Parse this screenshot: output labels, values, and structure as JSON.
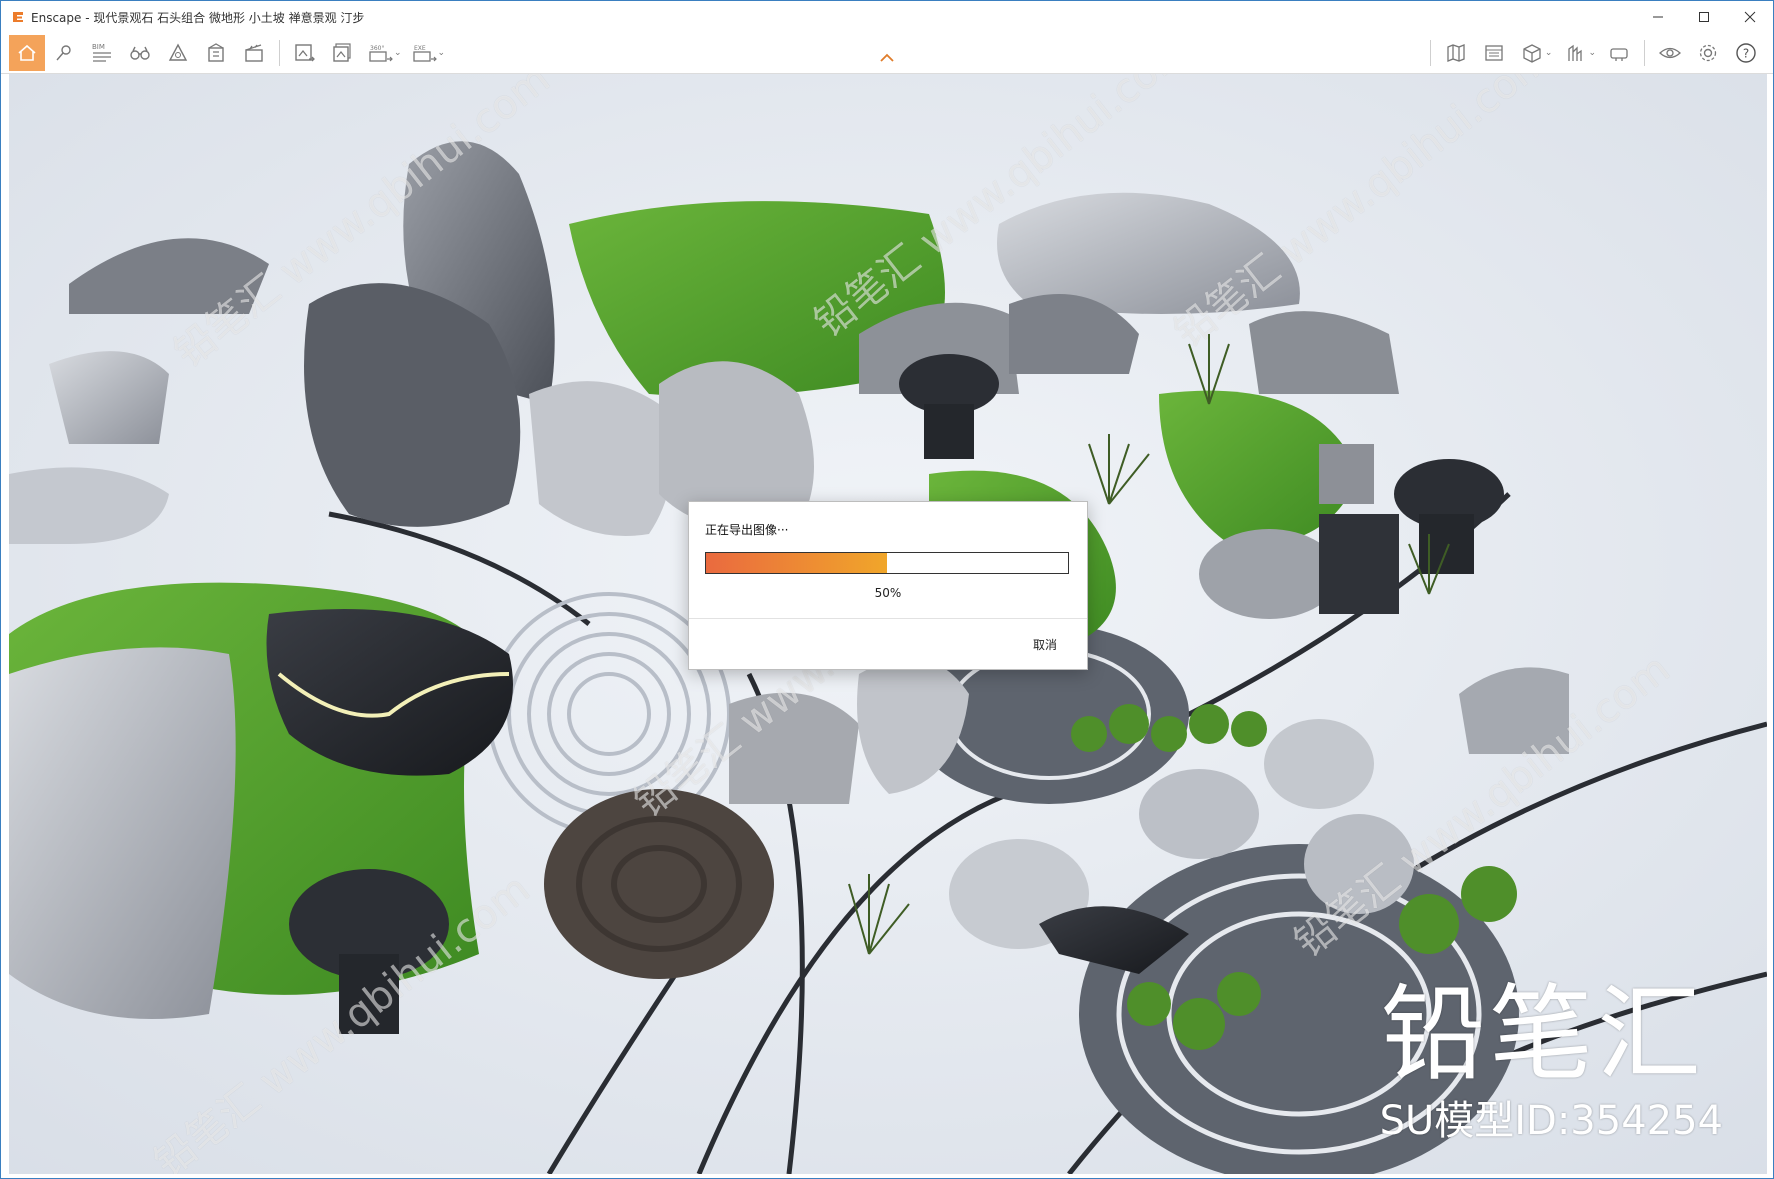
{
  "window": {
    "title": "Enscape - 现代景观石 石头组合 微地形 小土坡 禅意景观 汀步",
    "controls": [
      "minimize",
      "maximize",
      "close"
    ]
  },
  "toolbar": {
    "home_icon": "home-icon",
    "bim_label": "BIM",
    "pano_label": "360°",
    "exe_label": "EXE",
    "help_label": "?"
  },
  "dialog": {
    "title": "正在导出图像···",
    "progress": 0.5,
    "progress_label": "50%",
    "cancel_label": "取消"
  },
  "branding": {
    "logo_text": "铅笔汇",
    "model_id": "SU模型ID:354254",
    "watermark": "铅笔汇 www.qbihui.com"
  },
  "colors": {
    "accent": "#f4a35a",
    "progress_start": "#ea6a3f",
    "progress_end": "#f0a62a",
    "grass": "#4f9a2d",
    "gravel": "#e6eaf0",
    "rock": "#6d7077"
  }
}
